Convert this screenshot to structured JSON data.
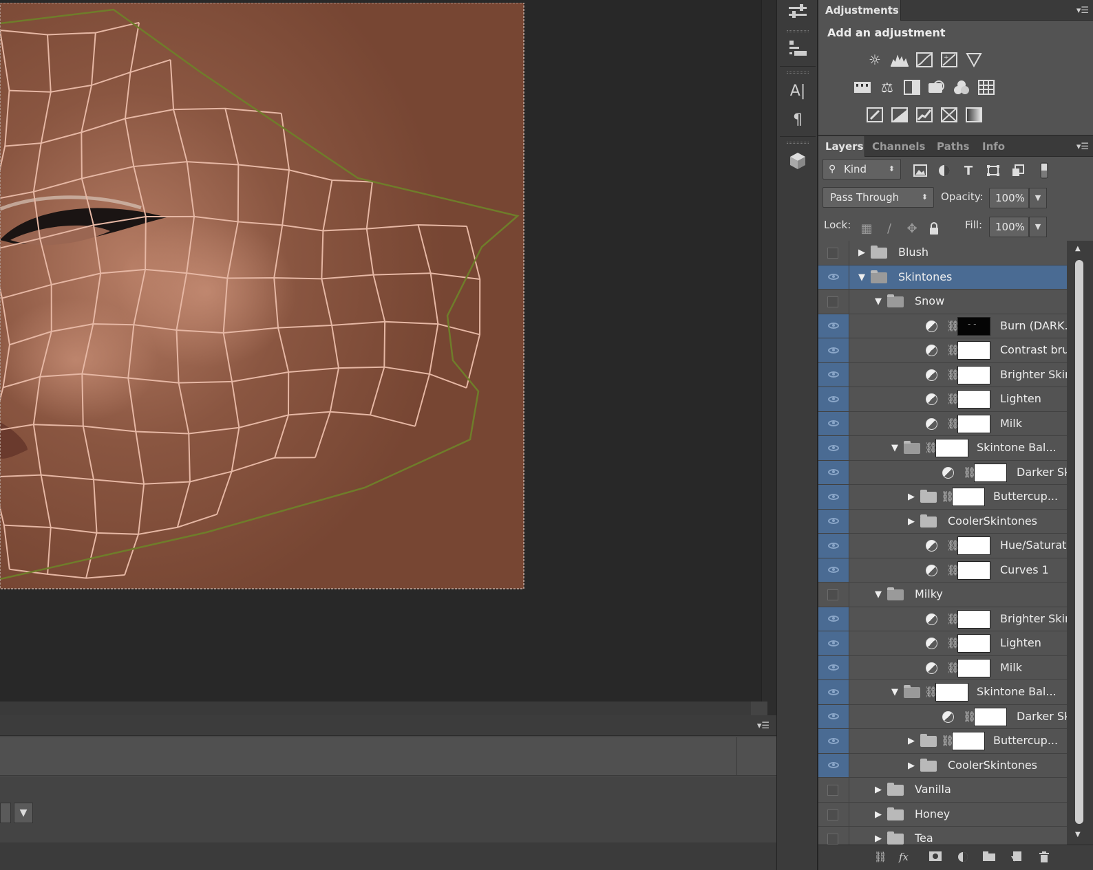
{
  "adjustments": {
    "tab_label": "Adjustments",
    "title": "Add an adjustment",
    "row1": [
      "brightness-contrast-icon",
      "levels-icon",
      "curves-icon",
      "exposure-icon",
      "vibrance-icon"
    ],
    "row2": [
      "hue-saturation-icon",
      "color-balance-icon",
      "black-white-icon",
      "photo-filter-icon",
      "channel-mixer-icon",
      "color-lookup-icon"
    ],
    "row3": [
      "invert-icon",
      "posterize-icon",
      "threshold-icon",
      "selective-color-icon",
      "gradient-map-icon"
    ]
  },
  "layers_panel": {
    "tabs": [
      "Layers",
      "Channels",
      "Paths",
      "Info"
    ],
    "filter_kind": "Kind",
    "blend_mode": "Pass Through",
    "opacity_label": "Opacity:",
    "opacity_value": "100%",
    "lock_label": "Lock:",
    "fill_label": "Fill:",
    "fill_value": "100%"
  },
  "layers": [
    {
      "name": "Blush",
      "kind": "group",
      "indent": 0,
      "expanded": false,
      "visible": false,
      "selected": false
    },
    {
      "name": "Skintones",
      "kind": "group",
      "indent": 0,
      "expanded": true,
      "visible": true,
      "selected": true
    },
    {
      "name": "Snow",
      "kind": "group",
      "indent": 1,
      "expanded": true,
      "visible": false,
      "selected": false
    },
    {
      "name": "Burn (DARK...",
      "kind": "adjustment",
      "indent": 2,
      "mask": "black",
      "visible": true
    },
    {
      "name": "Contrast bru...",
      "kind": "adjustment",
      "indent": 2,
      "mask": "white",
      "visible": true
    },
    {
      "name": "Brighter Skin",
      "kind": "adjustment",
      "indent": 2,
      "mask": "white",
      "visible": true
    },
    {
      "name": "Lighten",
      "kind": "adjustment",
      "indent": 2,
      "mask": "white",
      "visible": true
    },
    {
      "name": "Milk",
      "kind": "adjustment",
      "indent": 2,
      "mask": "white",
      "visible": true
    },
    {
      "name": "Skintone Bal...",
      "kind": "group-mask",
      "indent": 2,
      "expanded": true,
      "mask": "white",
      "visible": true
    },
    {
      "name": "Darker Skin",
      "kind": "adjustment",
      "indent": 3,
      "mask": "white",
      "visible": true
    },
    {
      "name": "Buttercup...",
      "kind": "group-mask",
      "indent": 3,
      "expanded": false,
      "mask": "white",
      "visible": true
    },
    {
      "name": "CoolerSkintones",
      "kind": "group",
      "indent": 3,
      "expanded": false,
      "visible": true
    },
    {
      "name": "Hue/Saturati...",
      "kind": "adjustment",
      "indent": 2,
      "mask": "white",
      "visible": true
    },
    {
      "name": "Curves 1",
      "kind": "adjustment",
      "indent": 2,
      "mask": "white",
      "visible": true
    },
    {
      "name": "Milky",
      "kind": "group",
      "indent": 1,
      "expanded": true,
      "visible": false,
      "selected": false
    },
    {
      "name": "Brighter Skin",
      "kind": "adjustment",
      "indent": 2,
      "mask": "white",
      "visible": true
    },
    {
      "name": "Lighten",
      "kind": "adjustment",
      "indent": 2,
      "mask": "white",
      "visible": true
    },
    {
      "name": "Milk",
      "kind": "adjustment",
      "indent": 2,
      "mask": "white",
      "visible": true
    },
    {
      "name": "Skintone Bal...",
      "kind": "group-mask",
      "indent": 2,
      "expanded": true,
      "mask": "white",
      "visible": true
    },
    {
      "name": "Darker Skin",
      "kind": "adjustment",
      "indent": 3,
      "mask": "white",
      "visible": true
    },
    {
      "name": "Buttercup...",
      "kind": "group-mask",
      "indent": 3,
      "expanded": false,
      "mask": "white",
      "visible": true
    },
    {
      "name": "CoolerSkintones",
      "kind": "group",
      "indent": 3,
      "expanded": false,
      "visible": true
    },
    {
      "name": "Vanilla",
      "kind": "group",
      "indent": 1,
      "expanded": false,
      "visible": false
    },
    {
      "name": "Honey",
      "kind": "group",
      "indent": 1,
      "expanded": false,
      "visible": false
    },
    {
      "name": "Tea",
      "kind": "group",
      "indent": 1,
      "expanded": false,
      "visible": false
    }
  ],
  "footer_icons": [
    "link-layers-icon",
    "fx-icon",
    "add-mask-icon",
    "new-adjustment-icon",
    "new-group-icon",
    "new-layer-icon",
    "delete-icon"
  ],
  "footer_fx": "fx",
  "colors": {
    "canvas_skin": "#7a4a36",
    "mesh_line": "#e6b7a4",
    "mesh_border": "#6f7d2a",
    "selection": "#4a6b93"
  }
}
